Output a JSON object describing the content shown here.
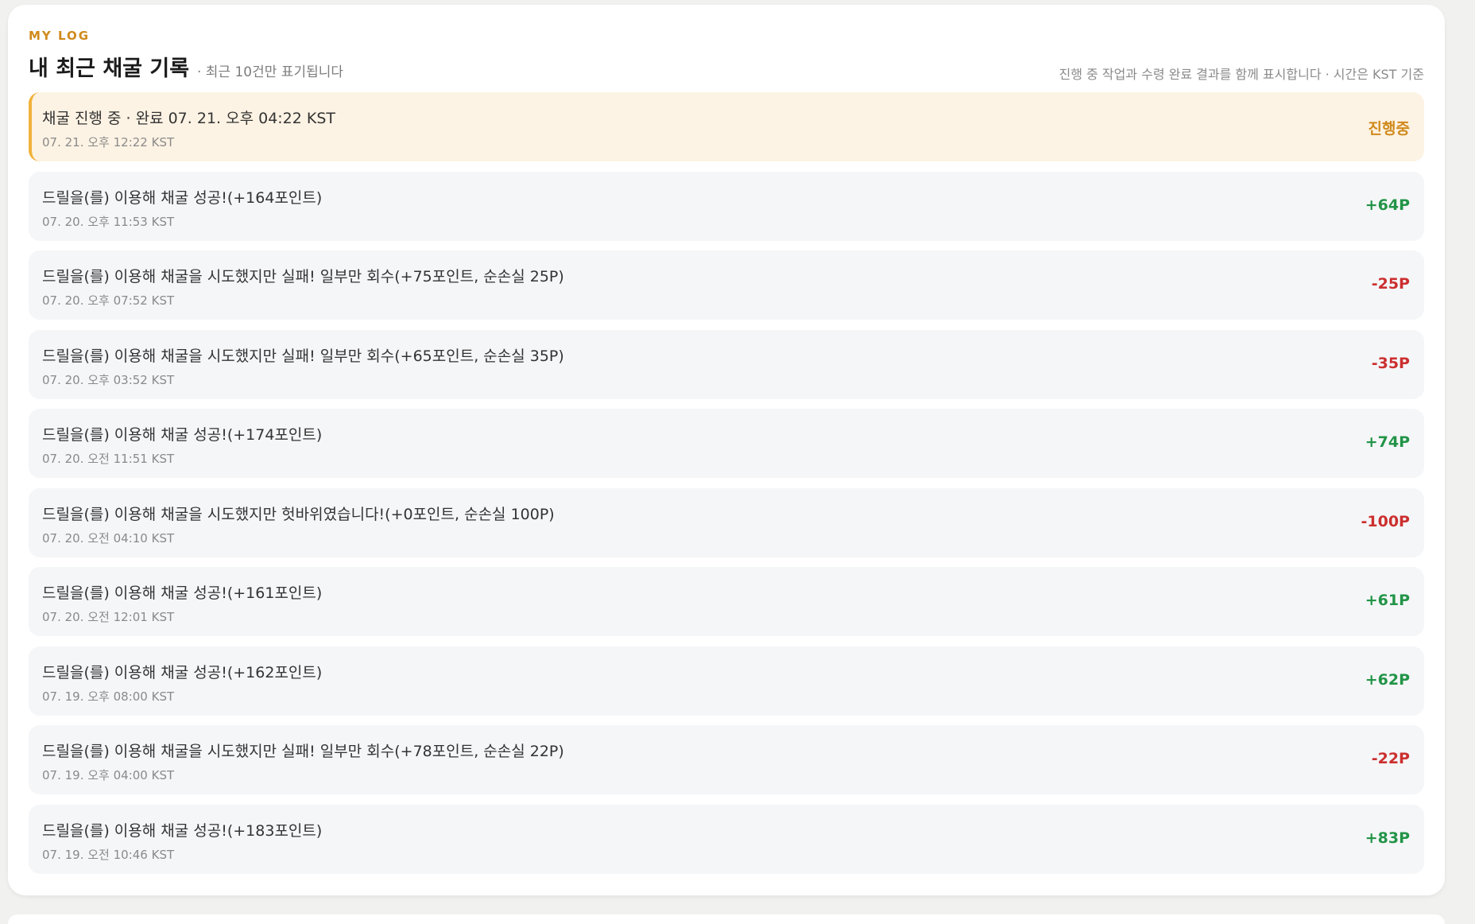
{
  "header": {
    "eyebrow": "MY LOG",
    "title": "내 최근 채굴 기록",
    "subtitle": "· 최근 10건만 표기됩니다",
    "note": "진행 중 작업과 수령 완료 결과를 함께 표시합니다 · 시간은 KST 기준"
  },
  "entries": [
    {
      "title": "채굴 진행 중 · 완료 07. 21. 오후 04:22 KST",
      "time": "07. 21. 오후 12:22 KST",
      "delta": "진행중",
      "kind": "pending"
    },
    {
      "title": "드릴을(를) 이용해 채굴 성공!(+164포인트)",
      "time": "07. 20. 오후 11:53 KST",
      "delta": "+64P",
      "kind": "gain"
    },
    {
      "title": "드릴을(를) 이용해 채굴을 시도했지만 실패! 일부만 회수(+75포인트, 순손실 25P)",
      "time": "07. 20. 오후 07:52 KST",
      "delta": "-25P",
      "kind": "loss"
    },
    {
      "title": "드릴을(를) 이용해 채굴을 시도했지만 실패! 일부만 회수(+65포인트, 순손실 35P)",
      "time": "07. 20. 오후 03:52 KST",
      "delta": "-35P",
      "kind": "loss"
    },
    {
      "title": "드릴을(를) 이용해 채굴 성공!(+174포인트)",
      "time": "07. 20. 오전 11:51 KST",
      "delta": "+74P",
      "kind": "gain"
    },
    {
      "title": "드릴을(를) 이용해 채굴을 시도했지만 헛바위였습니다!(+0포인트, 순손실 100P)",
      "time": "07. 20. 오전 04:10 KST",
      "delta": "-100P",
      "kind": "loss"
    },
    {
      "title": "드릴을(를) 이용해 채굴 성공!(+161포인트)",
      "time": "07. 20. 오전 12:01 KST",
      "delta": "+61P",
      "kind": "gain"
    },
    {
      "title": "드릴을(를) 이용해 채굴 성공!(+162포인트)",
      "time": "07. 19. 오후 08:00 KST",
      "delta": "+62P",
      "kind": "gain"
    },
    {
      "title": "드릴을(를) 이용해 채굴을 시도했지만 실패! 일부만 회수(+78포인트, 순손실 22P)",
      "time": "07. 19. 오후 04:00 KST",
      "delta": "-22P",
      "kind": "loss"
    },
    {
      "title": "드릴을(를) 이용해 채굴 성공!(+183포인트)",
      "time": "07. 19. 오전 10:46 KST",
      "delta": "+83P",
      "kind": "gain"
    }
  ],
  "colors": {
    "accent": "#d08a1c",
    "active_border": "#f0b23a",
    "active_bg": "#fdf3e4",
    "gain": "#229447",
    "loss": "#cc2f2f",
    "row_bg": "#f5f6f8"
  }
}
